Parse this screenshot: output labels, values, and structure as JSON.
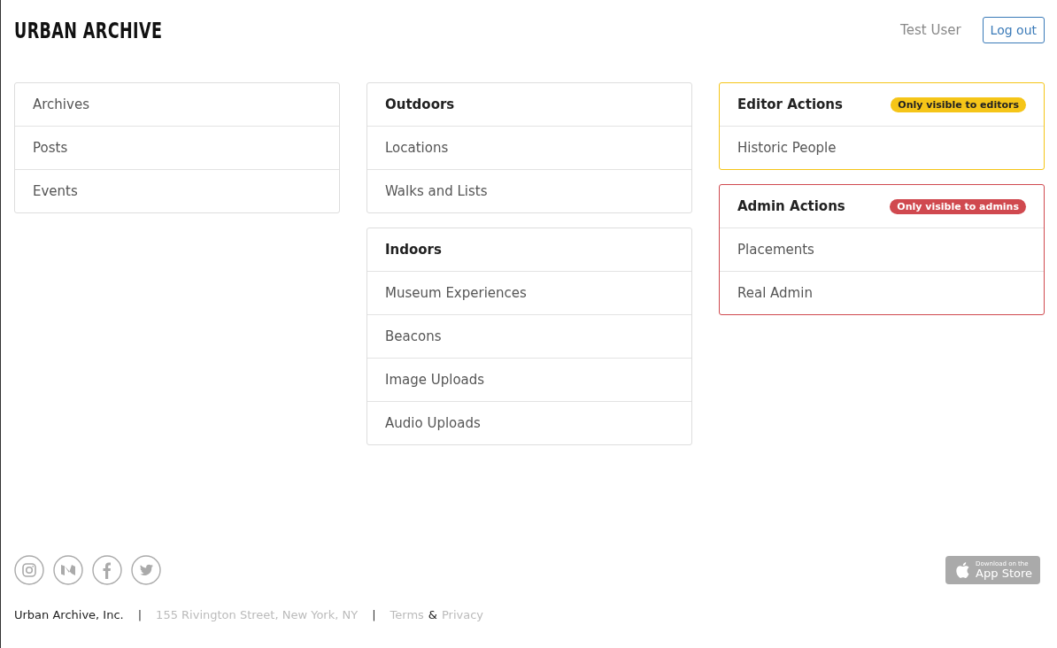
{
  "header": {
    "logo": "URBAN ARCHIVE",
    "user_name": "Test User",
    "logout": "Log out"
  },
  "columns": [
    [
      {
        "items": [
          "Archives",
          "Posts",
          "Events"
        ]
      }
    ],
    [
      {
        "heading": "Outdoors",
        "items": [
          "Locations",
          "Walks and Lists"
        ]
      },
      {
        "heading": "Indoors",
        "items": [
          "Museum Experiences",
          "Beacons",
          "Image Uploads",
          "Audio Uploads"
        ]
      }
    ],
    [
      {
        "heading": "Editor Actions",
        "badge": {
          "text": "Only visible to editors",
          "color": "#f5c518"
        },
        "items": [
          "Historic People"
        ]
      },
      {
        "heading": "Admin Actions",
        "badge": {
          "text": "Only visible to admins",
          "color": "#d0494f"
        },
        "items": [
          "Placements",
          "Real Admin"
        ]
      }
    ]
  ],
  "footer": {
    "company": "Urban Archive, Inc.",
    "separators": [
      "|",
      "|"
    ],
    "address": "155 Rivington Street, New York, NY",
    "terms": "Terms",
    "ampersand": "&",
    "privacy": "Privacy",
    "app_store": {
      "small": "Download on the",
      "large": "App Store"
    }
  }
}
